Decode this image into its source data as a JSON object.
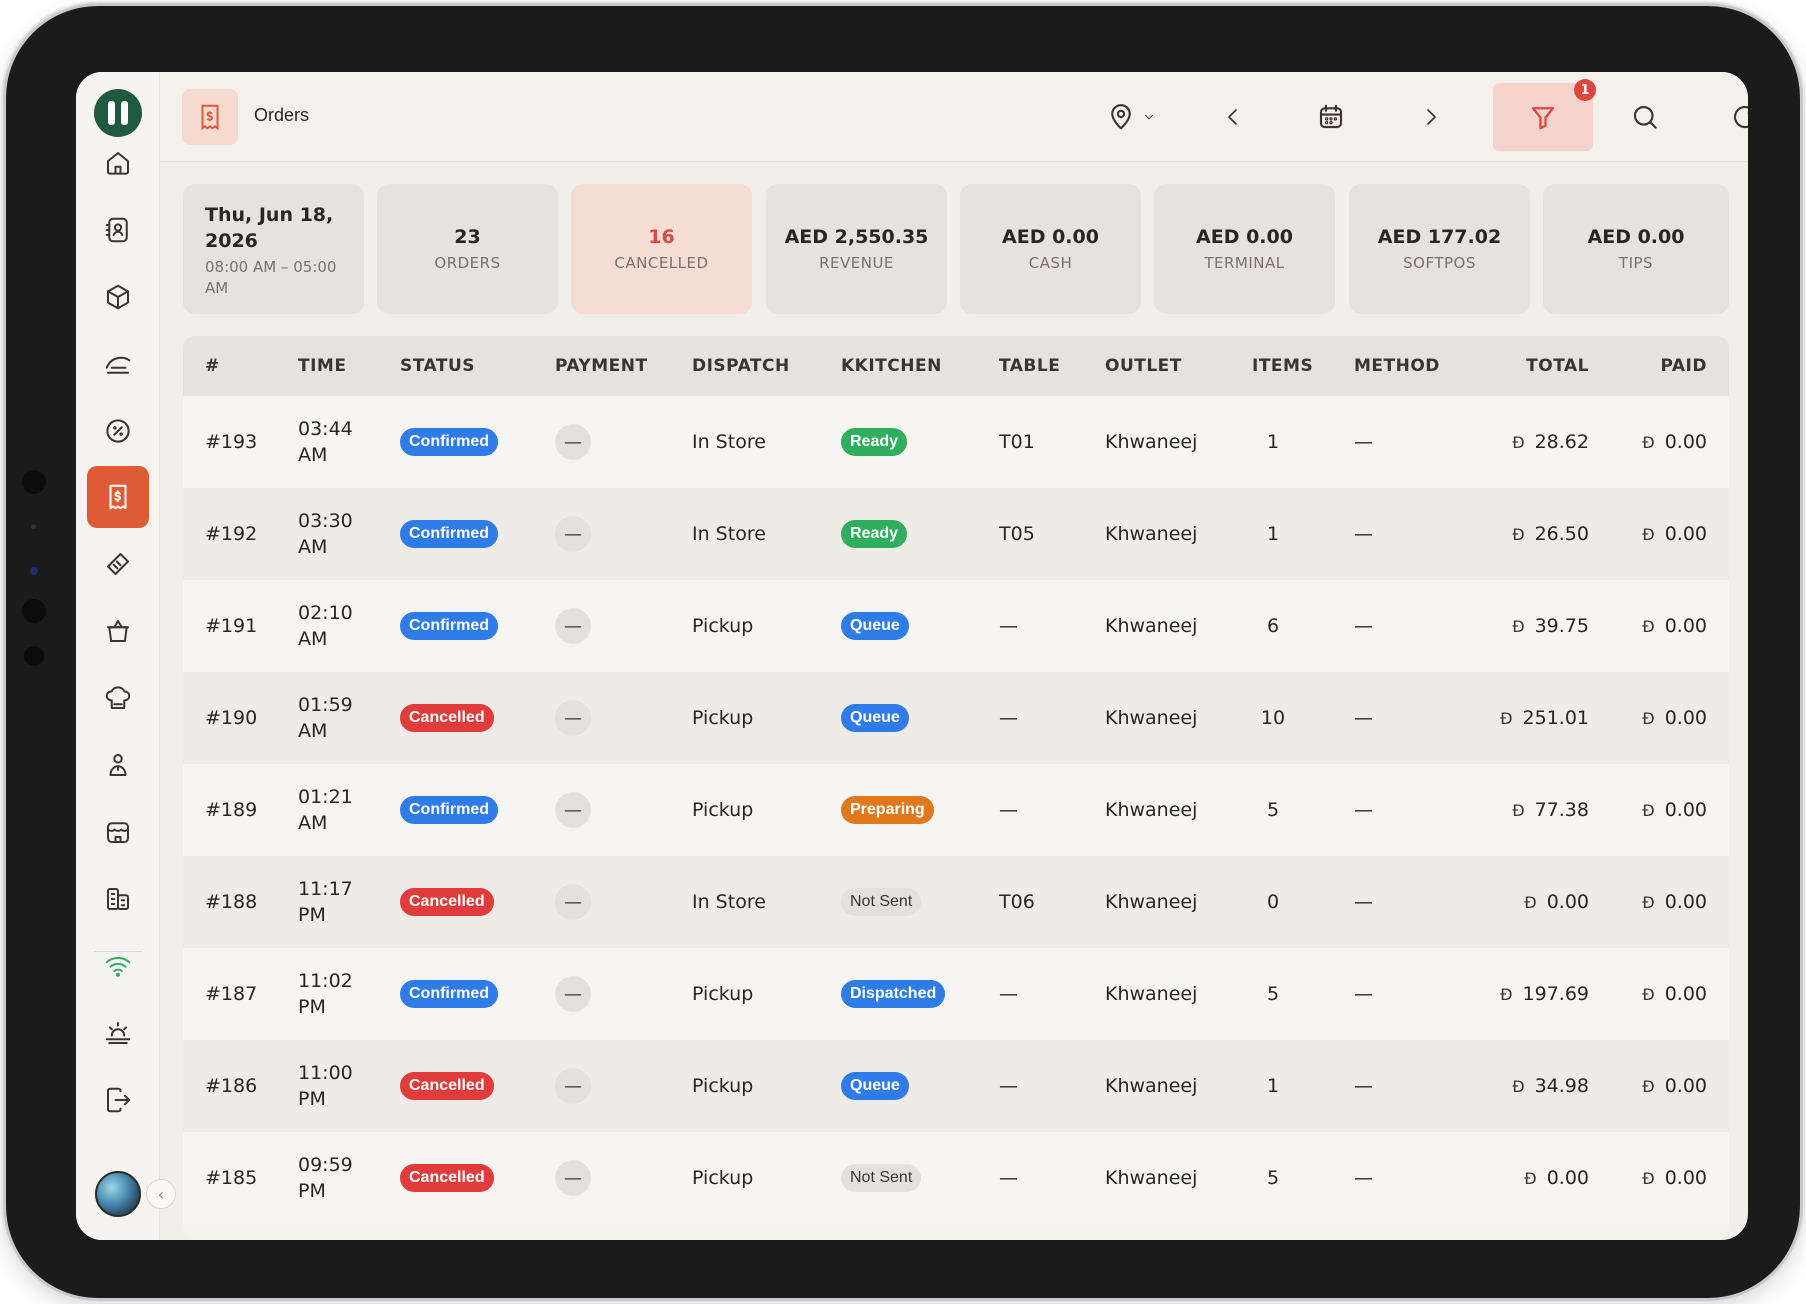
{
  "header": {
    "title": "Orders",
    "filter_badge": "1"
  },
  "sidebar": {
    "items": [
      {
        "name": "home-icon"
      },
      {
        "name": "contacts-icon"
      },
      {
        "name": "box-icon"
      },
      {
        "name": "delivery-icon"
      },
      {
        "name": "discount-icon"
      },
      {
        "name": "orders-icon",
        "active": true
      },
      {
        "name": "ticket-icon"
      },
      {
        "name": "basket-icon"
      },
      {
        "name": "chef-icon"
      },
      {
        "name": "staff-icon"
      },
      {
        "name": "store-icon"
      },
      {
        "name": "buildings-icon"
      },
      {
        "name": "wifi-icon"
      },
      {
        "name": "sun-icon"
      },
      {
        "name": "logout-icon"
      }
    ]
  },
  "stats": {
    "date": {
      "line1": "Thu, Jun 18,",
      "line2": "2026",
      "range1": "08:00 AM – 05:00",
      "range2": "AM"
    },
    "cards": [
      {
        "value": "23",
        "label": "ORDERS"
      },
      {
        "value": "16",
        "label": "CANCELLED"
      },
      {
        "value": "AED 2,550.35",
        "label": "REVENUE"
      },
      {
        "value": "AED 0.00",
        "label": "CASH"
      },
      {
        "value": "AED 0.00",
        "label": "TERMINAL"
      },
      {
        "value": "AED 177.02",
        "label": "SOFTPOS"
      },
      {
        "value": "AED 0.00",
        "label": "TIPS"
      }
    ]
  },
  "table": {
    "headers": [
      "#",
      "TIME",
      "STATUS",
      "PAYMENT",
      "DISPATCH",
      "KKITCHEN",
      "TABLE",
      "OUTLET",
      "ITEMS",
      "METHOD",
      "TOTAL",
      "PAID"
    ],
    "currency_symbol": "Đ",
    "rows": [
      {
        "id": "#193",
        "time1": "03:44",
        "time2": "AM",
        "status": "Confirmed",
        "payment": "—",
        "dispatch": "In Store",
        "kitchen": "Ready",
        "table": "T01",
        "outlet": "Khwaneej",
        "items": "1",
        "method": "—",
        "total": "28.62",
        "paid": "0.00"
      },
      {
        "id": "#192",
        "time1": "03:30",
        "time2": "AM",
        "status": "Confirmed",
        "payment": "—",
        "dispatch": "In Store",
        "kitchen": "Ready",
        "table": "T05",
        "outlet": "Khwaneej",
        "items": "1",
        "method": "—",
        "total": "26.50",
        "paid": "0.00"
      },
      {
        "id": "#191",
        "time1": "02:10",
        "time2": "AM",
        "status": "Confirmed",
        "payment": "—",
        "dispatch": "Pickup",
        "kitchen": "Queue",
        "table": "—",
        "outlet": "Khwaneej",
        "items": "6",
        "method": "—",
        "total": "39.75",
        "paid": "0.00"
      },
      {
        "id": "#190",
        "time1": "01:59",
        "time2": "AM",
        "status": "Cancelled",
        "payment": "—",
        "dispatch": "Pickup",
        "kitchen": "Queue",
        "table": "—",
        "outlet": "Khwaneej",
        "items": "10",
        "method": "—",
        "total": "251.01",
        "paid": "0.00"
      },
      {
        "id": "#189",
        "time1": "01:21",
        "time2": "AM",
        "status": "Confirmed",
        "payment": "—",
        "dispatch": "Pickup",
        "kitchen": "Preparing",
        "table": "—",
        "outlet": "Khwaneej",
        "items": "5",
        "method": "—",
        "total": "77.38",
        "paid": "0.00"
      },
      {
        "id": "#188",
        "time1": "11:17",
        "time2": "PM",
        "status": "Cancelled",
        "payment": "—",
        "dispatch": "In Store",
        "kitchen": "Not Sent",
        "table": "T06",
        "outlet": "Khwaneej",
        "items": "0",
        "method": "—",
        "total": "0.00",
        "paid": "0.00"
      },
      {
        "id": "#187",
        "time1": "11:02",
        "time2": "PM",
        "status": "Confirmed",
        "payment": "—",
        "dispatch": "Pickup",
        "kitchen": "Dispatched",
        "table": "—",
        "outlet": "Khwaneej",
        "items": "5",
        "method": "—",
        "total": "197.69",
        "paid": "0.00"
      },
      {
        "id": "#186",
        "time1": "11:00",
        "time2": "PM",
        "status": "Cancelled",
        "payment": "—",
        "dispatch": "Pickup",
        "kitchen": "Queue",
        "table": "—",
        "outlet": "Khwaneej",
        "items": "1",
        "method": "—",
        "total": "34.98",
        "paid": "0.00"
      },
      {
        "id": "#185",
        "time1": "09:59",
        "time2": "PM",
        "status": "Cancelled",
        "payment": "—",
        "dispatch": "Pickup",
        "kitchen": "Not Sent",
        "table": "—",
        "outlet": "Khwaneej",
        "items": "5",
        "method": "—",
        "total": "0.00",
        "paid": "0.00"
      }
    ]
  }
}
